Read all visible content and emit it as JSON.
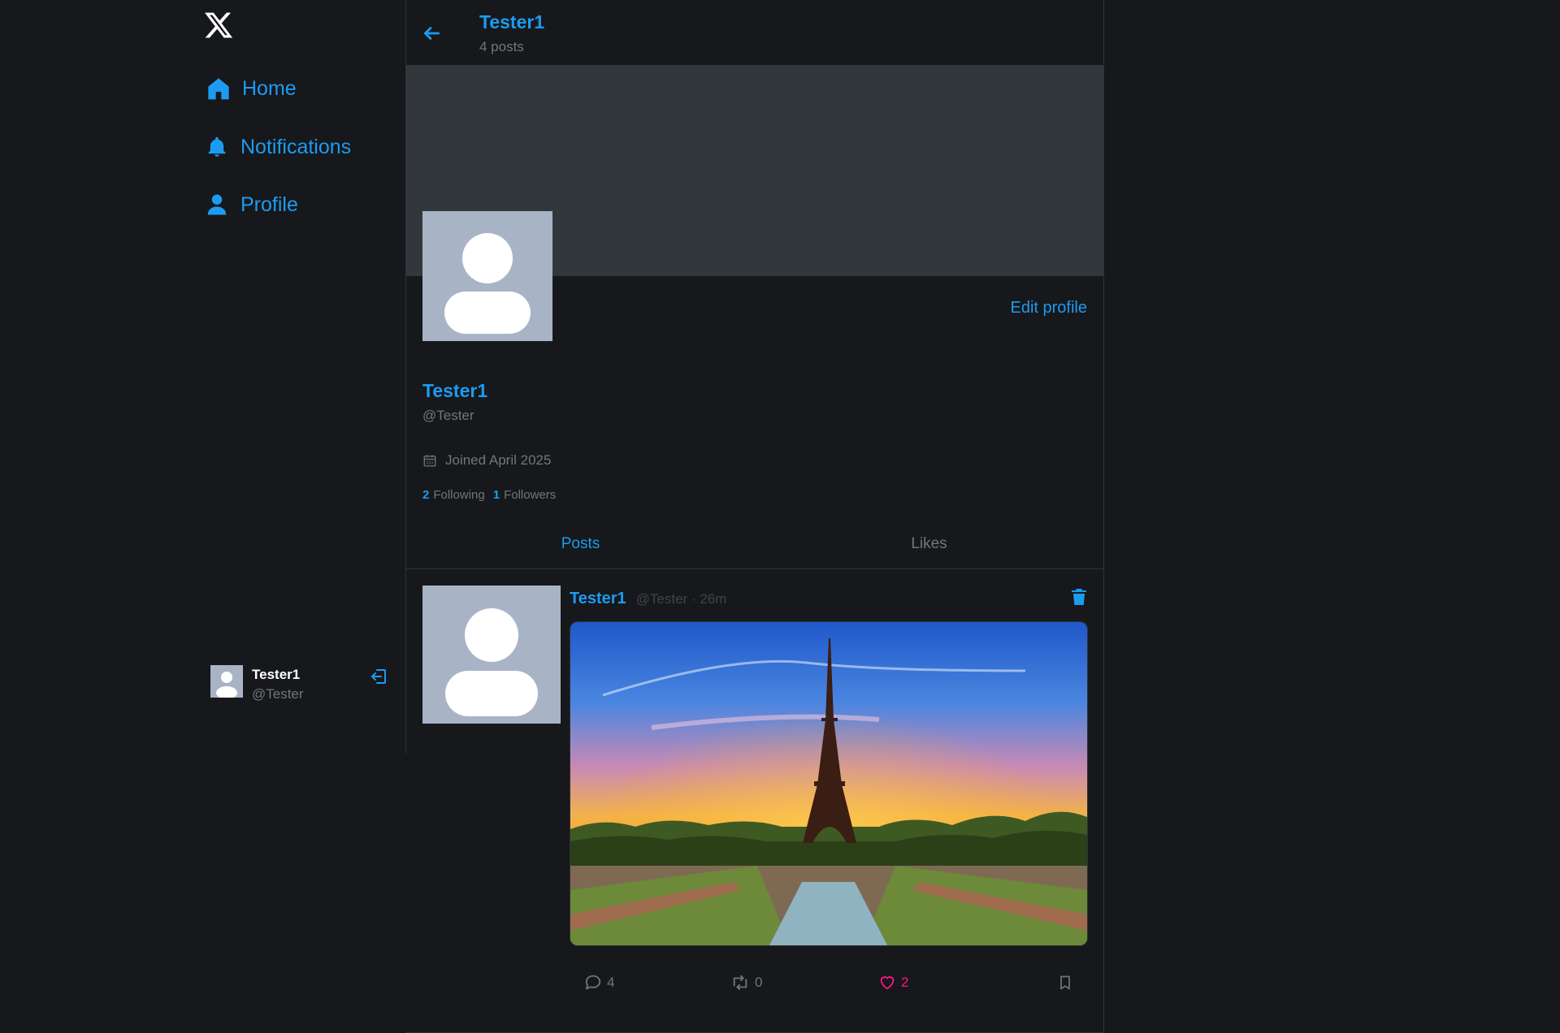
{
  "sidebar": {
    "logo": "x-logo-icon",
    "nav": [
      {
        "label": "Home",
        "icon": "home-icon"
      },
      {
        "label": "Notifications",
        "icon": "bell-icon"
      },
      {
        "label": "Profile",
        "icon": "user-icon"
      }
    ],
    "account": {
      "name": "Tester1",
      "handle": "@Tester",
      "logout_icon": "logout-icon"
    }
  },
  "header": {
    "title": "Tester1",
    "posts_count": "4 posts"
  },
  "profile": {
    "edit_label": "Edit profile",
    "name": "Tester1",
    "handle": "@Tester",
    "joined": "Joined April 2025",
    "following_count": "2",
    "following_label": "Following",
    "followers_count": "1",
    "followers_label": "Followers"
  },
  "tabs": [
    {
      "label": "Posts",
      "active": true
    },
    {
      "label": "Likes",
      "active": false
    }
  ],
  "post": {
    "name": "Tester1",
    "meta": "@Tester · 26m",
    "image": "eiffel-tower-sunset-photo",
    "replies": "4",
    "retweets": "0",
    "likes": "2"
  },
  "colors": {
    "accent": "#1d9bf0",
    "background": "#16181c",
    "banner": "#32373b",
    "like": "#f91880",
    "muted": "#71767b"
  }
}
